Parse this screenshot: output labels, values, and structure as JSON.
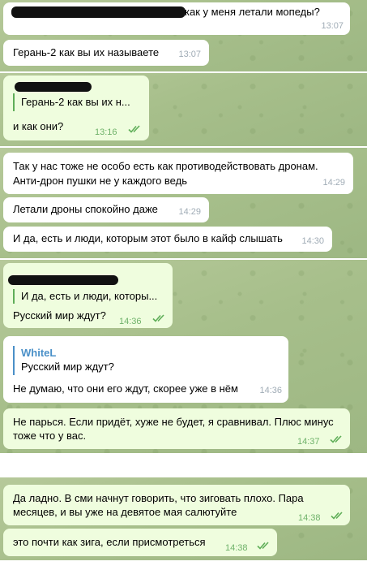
{
  "messages": [
    {
      "text": "как у меня летали мопеды?",
      "time": "13:07"
    },
    {
      "text": "Герань-2 как вы их называете",
      "time": "13:07"
    },
    {
      "reply_quote": "Герань-2 как вы их н...",
      "text": "и как они?",
      "time": "13:16"
    },
    {
      "lines": [
        "Так у нас тоже не особо есть как противодействовать дронам.",
        "Анти-дрон пушки не у каждого ведь"
      ],
      "time": "14:29"
    },
    {
      "text": "Летали дроны спокойно даже",
      "time": "14:29"
    },
    {
      "text": "И да, есть и люди, которым этот было в кайф слышать",
      "time": "14:30"
    },
    {
      "reply_quote": "И да, есть и люди, которы...",
      "text": "Русский мир ждут?",
      "time": "14:36"
    },
    {
      "reply_author": "WhiteL",
      "reply_quote": "Русский мир ждут?",
      "text": "Не думаю, что они его ждут, скорее уже в нём",
      "time": "14:36"
    },
    {
      "lines": [
        "Не парься. Если придёт, хуже не будет, я сравнивал. Плюс минус",
        "тоже что у вас."
      ],
      "time": "14:37"
    },
    {
      "lines": [
        "Да ладно. В сми начнут говорить, что зиговать плохо. Пара",
        "месяцев, и вы уже на девятое мая салютуйте"
      ],
      "time": "14:38"
    },
    {
      "text": "это почти как зига, если присмотреться",
      "time": "14:38"
    }
  ],
  "colors": {
    "incoming": "#ffffff",
    "outgoing": "#effdde",
    "read_ticks": "#5fae58",
    "quote_bar": "#5fae58",
    "author": "#4a90c8"
  },
  "icons": [
    "double-check-icon"
  ]
}
